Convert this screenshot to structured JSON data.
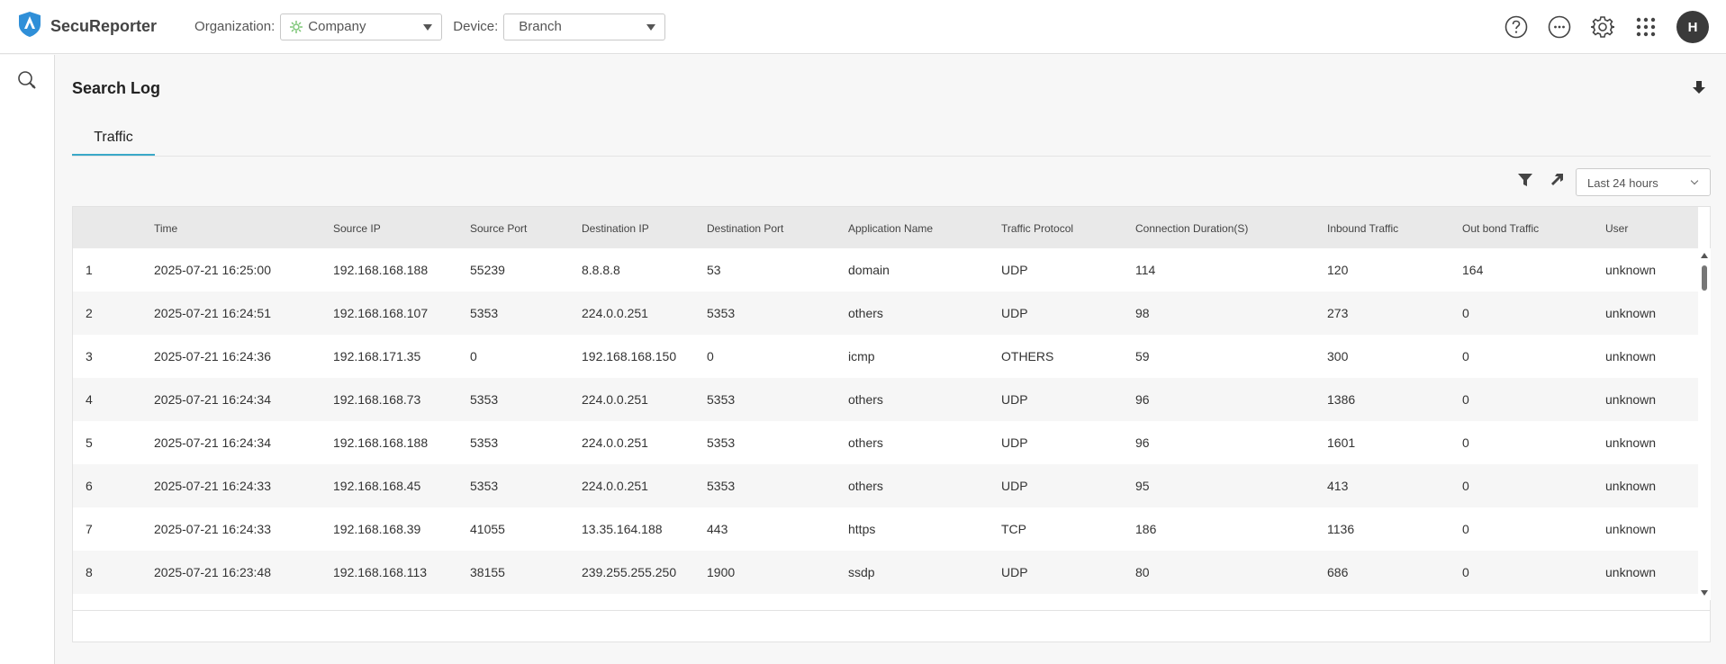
{
  "app": {
    "name": "SecuReporter"
  },
  "header": {
    "org_label": "Organization:",
    "org_value": "Company",
    "device_label": "Device:",
    "device_value": "Branch",
    "avatar_initial": "H"
  },
  "page": {
    "title": "Search Log",
    "tab": "Traffic",
    "range": "Last 24 hours"
  },
  "table": {
    "columns": [
      "",
      "Time",
      "Source IP",
      "Source Port",
      "Destination IP",
      "Destination Port",
      "Application Name",
      "Traffic Protocol",
      "Connection Duration(S)",
      "Inbound Traffic",
      "Out bond Traffic",
      "User"
    ],
    "rows": [
      [
        "1",
        "2025-07-21 16:25:00",
        "192.168.168.188",
        "55239",
        "8.8.8.8",
        "53",
        "domain",
        "UDP",
        "114",
        "120",
        "164",
        "unknown"
      ],
      [
        "2",
        "2025-07-21 16:24:51",
        "192.168.168.107",
        "5353",
        "224.0.0.251",
        "5353",
        "others",
        "UDP",
        "98",
        "273",
        "0",
        "unknown"
      ],
      [
        "3",
        "2025-07-21 16:24:36",
        "192.168.171.35",
        "0",
        "192.168.168.150",
        "0",
        "icmp",
        "OTHERS",
        "59",
        "300",
        "0",
        "unknown"
      ],
      [
        "4",
        "2025-07-21 16:24:34",
        "192.168.168.73",
        "5353",
        "224.0.0.251",
        "5353",
        "others",
        "UDP",
        "96",
        "1386",
        "0",
        "unknown"
      ],
      [
        "5",
        "2025-07-21 16:24:34",
        "192.168.168.188",
        "5353",
        "224.0.0.251",
        "5353",
        "others",
        "UDP",
        "96",
        "1601",
        "0",
        "unknown"
      ],
      [
        "6",
        "2025-07-21 16:24:33",
        "192.168.168.45",
        "5353",
        "224.0.0.251",
        "5353",
        "others",
        "UDP",
        "95",
        "413",
        "0",
        "unknown"
      ],
      [
        "7",
        "2025-07-21 16:24:33",
        "192.168.168.39",
        "41055",
        "13.35.164.188",
        "443",
        "https",
        "TCP",
        "186",
        "1136",
        "0",
        "unknown"
      ],
      [
        "8",
        "2025-07-21 16:23:48",
        "192.168.168.113",
        "38155",
        "239.255.255.250",
        "1900",
        "ssdp",
        "UDP",
        "80",
        "686",
        "0",
        "unknown"
      ]
    ]
  },
  "colors": {
    "accent": "#3aa8c8",
    "logo": "#2f8fd8",
    "header_bg": "#e9e9e9"
  }
}
